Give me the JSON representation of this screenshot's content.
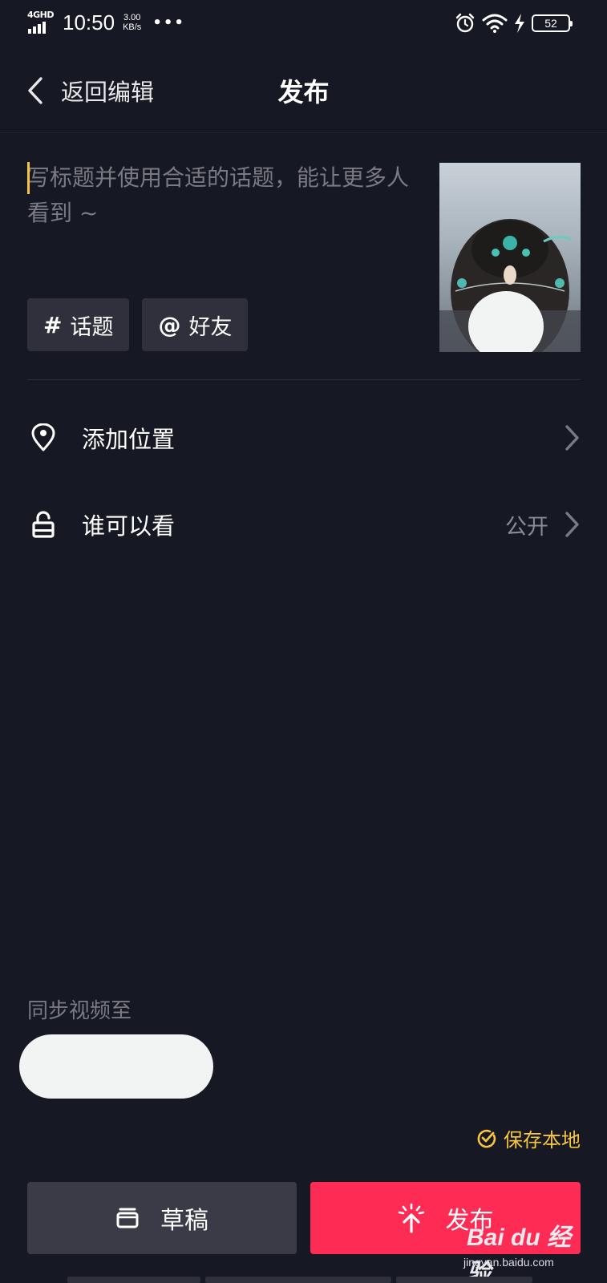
{
  "status_bar": {
    "network": "4GHD",
    "time": "10:50",
    "speed_value": "3.00",
    "speed_unit": "KB/s",
    "more": "•••",
    "battery": "52",
    "icons": [
      "alarm-icon",
      "wifi-icon",
      "charging-icon",
      "battery-icon"
    ]
  },
  "nav": {
    "back_label": "返回编辑",
    "title": "发布"
  },
  "caption": {
    "placeholder": "写标题并使用合适的话题，能让更多人看到 ~",
    "value": ""
  },
  "chips": {
    "topic": {
      "symbol": "#",
      "label": "话题"
    },
    "friend": {
      "symbol": "@",
      "label": "好友"
    }
  },
  "rows": {
    "location": {
      "label": "添加位置",
      "icon": "location-pin-icon"
    },
    "visibility": {
      "label": "谁可以看",
      "value": "公开",
      "icon": "unlock-icon"
    }
  },
  "sync": {
    "label": "同步视频至"
  },
  "save_local": {
    "label": "保存本地",
    "checked": true
  },
  "buttons": {
    "draft": "草稿",
    "publish": "发布"
  },
  "watermark": {
    "main": "Bai du 经验",
    "sub": "jingyan.baidu.com"
  },
  "colors": {
    "background": "#161823",
    "accent": "#fe2c55",
    "highlight": "#f7c53f",
    "chip": "#2f303b",
    "secondary_button": "#3a3b47"
  }
}
